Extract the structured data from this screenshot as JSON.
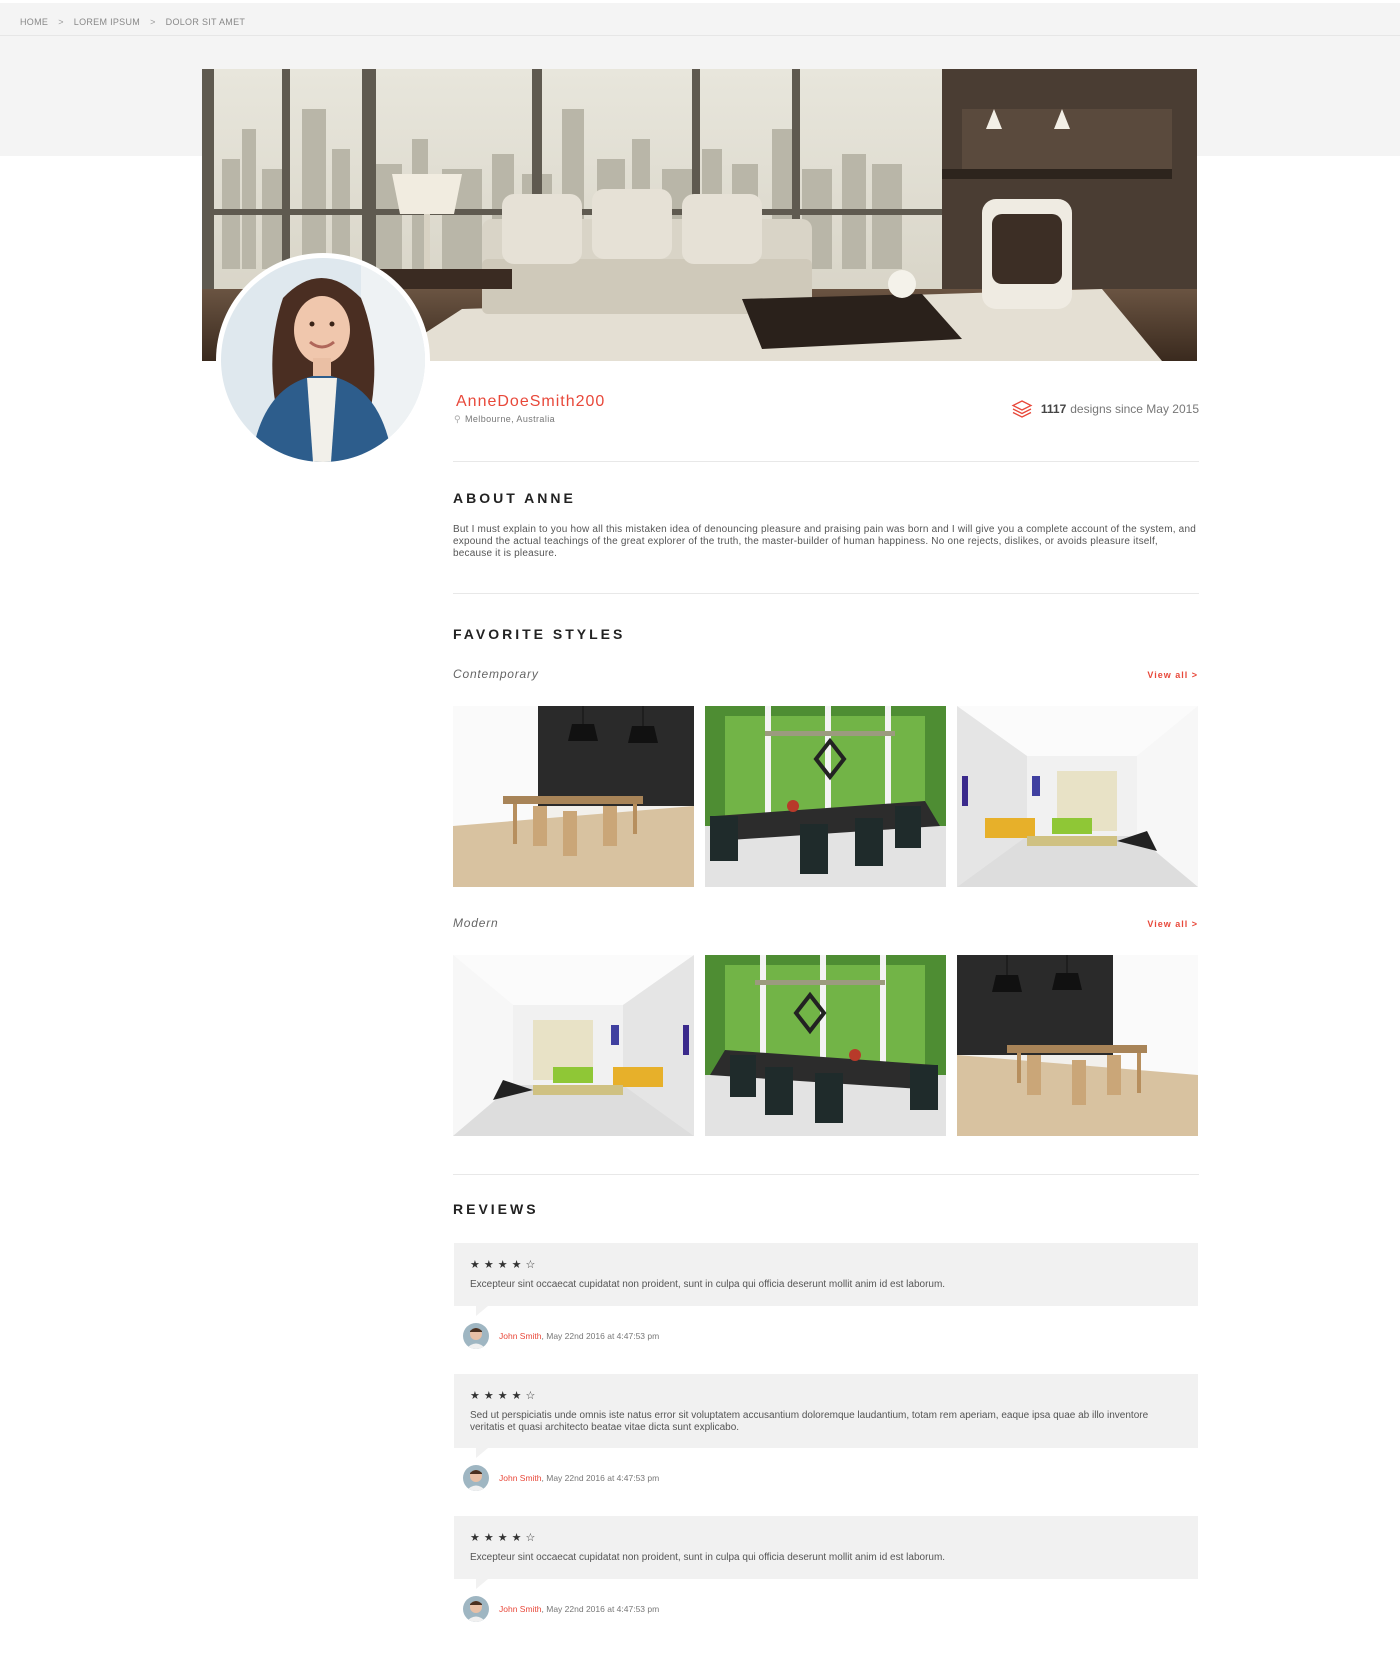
{
  "breadcrumb": {
    "items": [
      "HOME",
      "LOREM IPSUM",
      "DOLOR SIT AMET"
    ],
    "separator": ">"
  },
  "profile": {
    "username": "AnneDoeSmith200",
    "location": "Melbourne, Australia",
    "designs_count": "1117",
    "designs_suffix": "designs since May 2015"
  },
  "about": {
    "title": "ABOUT ANNE",
    "text": "But I must explain to you how all this mistaken idea of denouncing pleasure and praising pain was born and I will give you a complete account of the system, and expound the actual teachings of the great explorer of the truth, the master-builder of human happiness. No one rejects, dislikes, or avoids pleasure itself, because it is pleasure."
  },
  "favorite_styles": {
    "title": "FAVORITE STYLES",
    "groups": [
      {
        "name": "Contemporary",
        "view_all": "View all >"
      },
      {
        "name": "Modern",
        "view_all": "View all >"
      }
    ]
  },
  "reviews": {
    "title": "REVIEWS",
    "items": [
      {
        "stars": "★★★★☆",
        "rating": 4,
        "text": "Excepteur sint occaecat cupidatat non proident, sunt in culpa qui officia deserunt mollit anim id est laborum.",
        "author": "John Smith",
        "date": ", May 22nd 2016 at 4:47:53 pm"
      },
      {
        "stars": "★★★★☆",
        "rating": 4,
        "text": "Sed ut perspiciatis unde omnis iste natus error sit voluptatem accusantium doloremque laudantium, totam rem aperiam, eaque ipsa quae ab illo inventore veritatis et quasi architecto beatae vitae dicta sunt explicabo.",
        "author": "John Smith",
        "date": ", May 22nd 2016 at 4:47:53 pm"
      },
      {
        "stars": "★★★★☆",
        "rating": 4,
        "text": "Excepteur sint occaecat cupidatat non proident, sunt in culpa qui officia deserunt mollit anim id est laborum.",
        "author": "John Smith",
        "date": ", May 22nd 2016 at 4:47:53 pm"
      }
    ]
  },
  "colors": {
    "accent": "#e8483a",
    "band": "#f4f4f4",
    "review_bg": "#f1f1f1"
  }
}
